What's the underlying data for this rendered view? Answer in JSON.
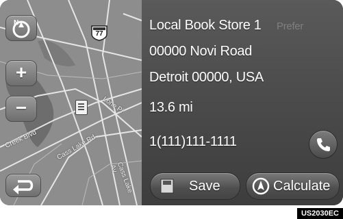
{
  "poi": {
    "name": "Local Book Store 1",
    "name_ghost_suffix": "Prefer",
    "street": "00000 Novi Road",
    "city_line": "Detroit 00000, USA",
    "distance": "13.6 mi",
    "phone": "1(111)111-1111"
  },
  "map": {
    "route_shield": "77",
    "zoom_in_glyph": "+",
    "zoom_out_glyph": "−",
    "street_labels": [
      "Lone Pi",
      "Cass Lake Rd",
      "Creek Blvd",
      "Cass Lake Av"
    ]
  },
  "buttons": {
    "save_label": "Save",
    "calculate_label": "Calculate"
  },
  "image_code": "US2030EC",
  "icons": [
    "north-up-compass-icon",
    "zoom-in-icon",
    "zoom-out-icon",
    "back-icon",
    "phone-icon",
    "save-icon",
    "calculate-icon",
    "poi-pin-icon",
    "route-shield-icon"
  ]
}
